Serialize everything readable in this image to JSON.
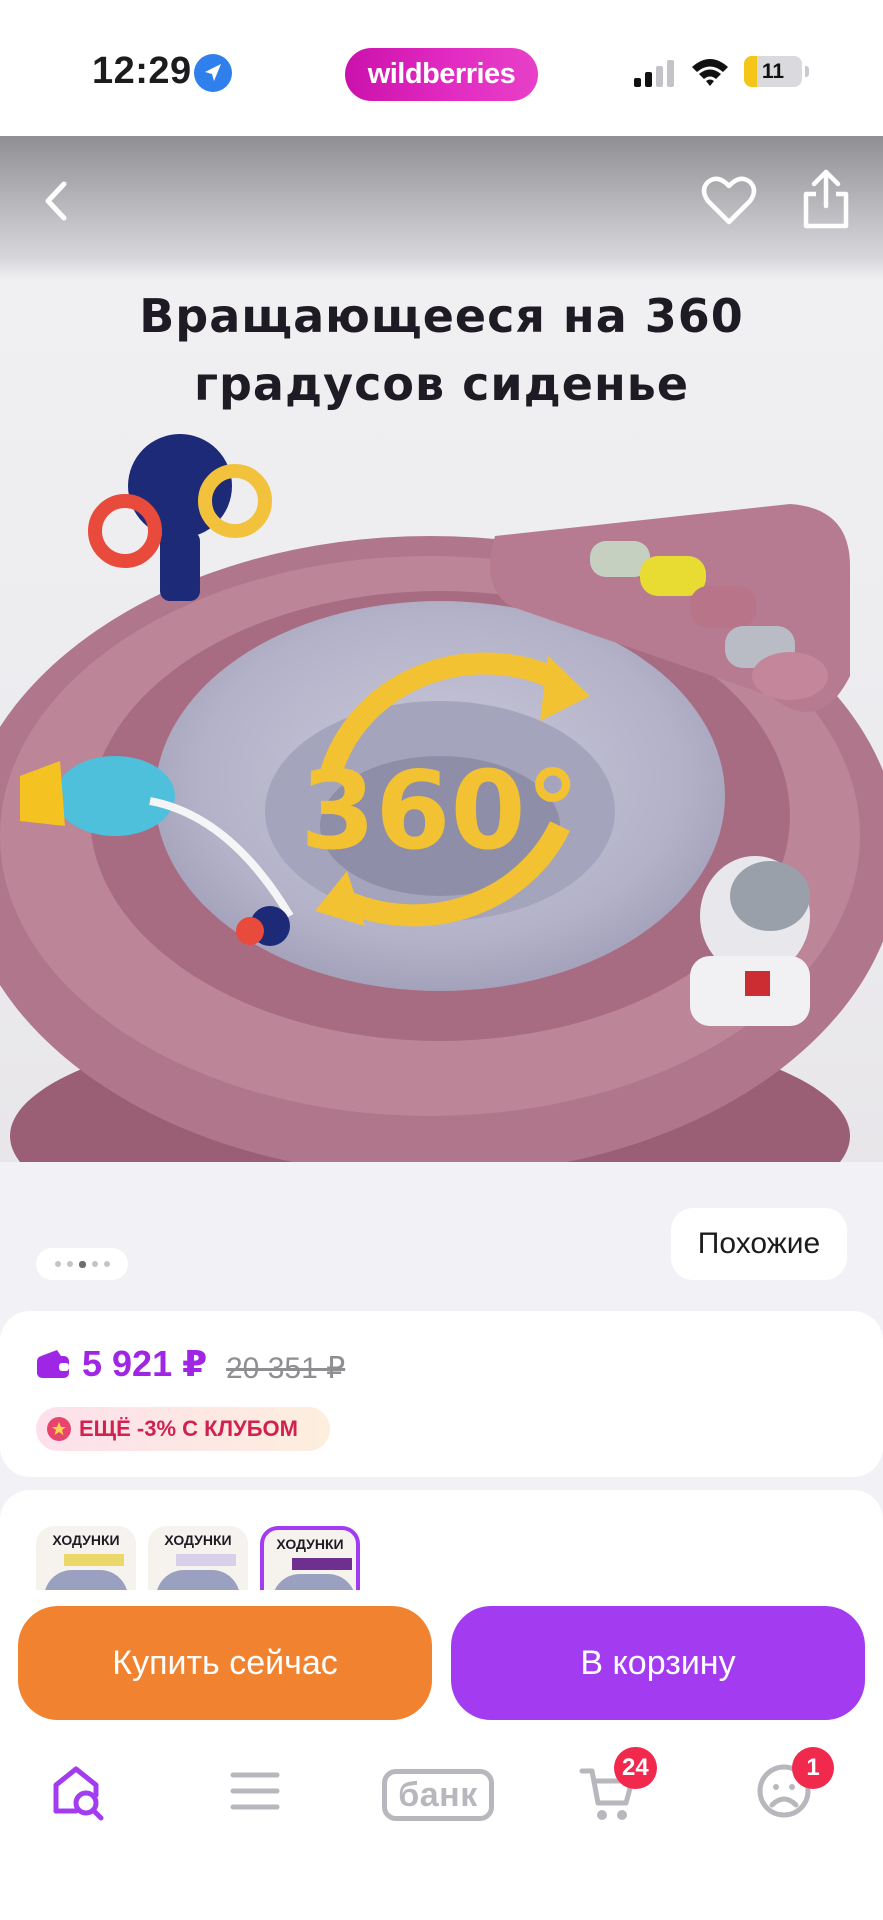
{
  "status_bar": {
    "time": "12:29",
    "brand": "wildberries",
    "battery_level": "11"
  },
  "gallery": {
    "photo_caption_line1": "Вращающееся на 360",
    "photo_caption_line2": "градусов сиденье",
    "photo_badge": "360°",
    "image_count": 5,
    "active_image_index": 2,
    "similar_label": "Похожие"
  },
  "price": {
    "current": "5 921 ₽",
    "old": "20 351 ₽",
    "club_offer": "ЕЩЁ -3% С КЛУБОМ",
    "accent_color": "#9f26e4"
  },
  "variants": {
    "items": [
      {
        "title": "ХОДУНКИ",
        "selected": false
      },
      {
        "title": "ХОДУНКИ",
        "selected": false
      },
      {
        "title": "ХОДУНКИ",
        "selected": true
      }
    ]
  },
  "actions": {
    "buy_now_label": "Купить сейчас",
    "add_to_cart_label": "В корзину",
    "buy_now_color": "#f08230",
    "add_to_cart_color": "#a33cf0"
  },
  "tab_bar": {
    "items": [
      {
        "name": "home",
        "icon": "search-home-icon"
      },
      {
        "name": "catalog",
        "icon": "menu-icon"
      },
      {
        "name": "bank",
        "label": "банк"
      },
      {
        "name": "cart",
        "icon": "cart-icon",
        "badge": "24"
      },
      {
        "name": "profile",
        "icon": "profile-icon",
        "badge": "1"
      }
    ]
  }
}
